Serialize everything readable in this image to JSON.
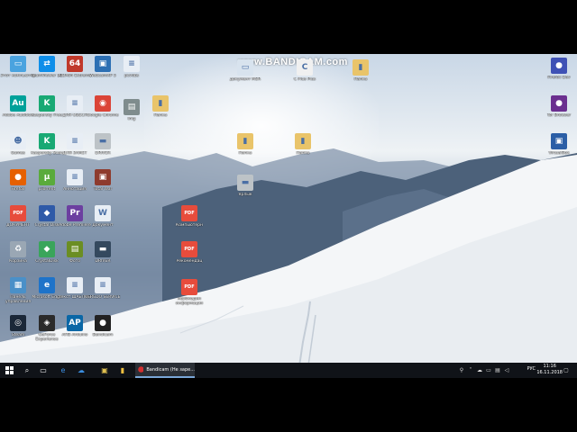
{
  "watermark": "www.BANDICAM.com",
  "taskbar": {
    "app_label": "Bandicam (Не заре...",
    "lang": "РУС",
    "time": "11:16",
    "date": "16.11.2018"
  },
  "icons": [
    {
      "id": "ic1",
      "label": "Этот компьютер",
      "color": "#4aa3df",
      "glyph": "▭"
    },
    {
      "id": "ic2",
      "label": "TeamViewer 13",
      "color": "#0e8ee9",
      "glyph": "⇄"
    },
    {
      "id": "ic3",
      "label": "AIDA64 Extreme",
      "color": "#c0392b",
      "glyph": "64"
    },
    {
      "id": "ic4",
      "label": "WebcamXP 5",
      "color": "#2c6fb3",
      "glyph": "▣"
    },
    {
      "id": "ic5",
      "label": "pcvdbs",
      "color": "#e8eef5",
      "glyph": "≡"
    },
    {
      "id": "ic6",
      "label": "документ MSR",
      "color": "#d8e3ee",
      "glyph": "▭"
    },
    {
      "id": "ic7",
      "label": "C Plus Plus",
      "color": "#f0f0f0",
      "glyph": "C"
    },
    {
      "id": "ic8",
      "label": "Папка",
      "color": "#e9c46a",
      "glyph": "▮"
    },
    {
      "id": "ic9",
      "label": "Adobe Audition",
      "color": "#00a19a",
      "glyph": "Au"
    },
    {
      "id": "ic10",
      "label": "Kaspersky Free",
      "color": "#19a974",
      "glyph": "K"
    },
    {
      "id": "ic11",
      "label": "ДЛЯ ОБЕСП",
      "color": "#e8eef5",
      "glyph": "≡"
    },
    {
      "id": "ic12",
      "label": "Google Chrome",
      "color": "#db4437",
      "glyph": "◉"
    },
    {
      "id": "ic13",
      "label": "Img",
      "color": "#7f8c8d",
      "glyph": "▤"
    },
    {
      "id": "ic14",
      "label": "Папка",
      "color": "#e9c46a",
      "glyph": "▮"
    },
    {
      "id": "ic15",
      "label": "Games",
      "color": "#e8eef5",
      "glyph": "☻"
    },
    {
      "id": "ic16",
      "label": "Kaspersky Scan",
      "color": "#19a974",
      "glyph": "K"
    },
    {
      "id": "ic17",
      "label": "ДЛЯ ЗАМЕТ",
      "color": "#e8eef5",
      "glyph": "≡"
    },
    {
      "id": "ic18",
      "label": "DRIVER",
      "color": "#bdc3c7",
      "glyph": "▬"
    },
    {
      "id": "ic19",
      "label": "Папка",
      "color": "#e9c46a",
      "glyph": "▮"
    },
    {
      "id": "ic20",
      "label": "Папка",
      "color": "#e9c46a",
      "glyph": "▮"
    },
    {
      "id": "ic21",
      "label": "Firefox",
      "color": "#e66000",
      "glyph": "●"
    },
    {
      "id": "ic22",
      "label": "µTorrent",
      "color": "#5aab3c",
      "glyph": "µ"
    },
    {
      "id": "ic23",
      "label": "Аннотация",
      "color": "#e8eef5",
      "glyph": "≡"
    },
    {
      "id": "ic24",
      "label": "Total War",
      "color": "#8e3b2d",
      "glyph": "▣"
    },
    {
      "id": "ic25",
      "label": "Ярлык",
      "color": "#bdc3c7",
      "glyph": "▬"
    },
    {
      "id": "ic26",
      "label": "ДОКУМЕНТ",
      "color": "#e74c3c",
      "glyph": "PDF"
    },
    {
      "id": "ic27",
      "label": "Crystal Disk",
      "color": "#2f5aa8",
      "glyph": "◆"
    },
    {
      "id": "ic28",
      "label": "Adobe Premiere",
      "color": "#6c3fa0",
      "glyph": "Pr"
    },
    {
      "id": "ic29",
      "label": "Документ",
      "color": "#e8eef5",
      "glyph": "W"
    },
    {
      "id": "ic30",
      "label": "Компьютерн",
      "color": "#e74c3c",
      "glyph": "PDF"
    },
    {
      "id": "ic31",
      "label": "Корзина",
      "color": "#9aa7b4",
      "glyph": "♻"
    },
    {
      "id": "ic32",
      "label": "CrystalDisk",
      "color": "#3aa55b",
      "glyph": "◆"
    },
    {
      "id": "ic33",
      "label": "Фото",
      "color": "#6b8e23",
      "glyph": "▤"
    },
    {
      "id": "ic34",
      "label": "DRIVER",
      "color": "#34495e",
      "glyph": "▬"
    },
    {
      "id": "ic35",
      "label": "Рекомендац",
      "color": "#e74c3c",
      "glyph": "PDF"
    },
    {
      "id": "ic36",
      "label": "Панель управления",
      "color": "#4a90c8",
      "glyph": "▦"
    },
    {
      "id": "ic37",
      "label": "Microsoft Edge",
      "color": "#1e73c9",
      "glyph": "e"
    },
    {
      "id": "ic38",
      "label": "текст ШАБЛОН",
      "color": "#e8eef5",
      "glyph": "≡"
    },
    {
      "id": "ic39",
      "label": "TEREDO SERVICE",
      "color": "#e8eef5",
      "glyph": "≡"
    },
    {
      "id": "ic40",
      "label": "необходим информация",
      "color": "#e74c3c",
      "glyph": "PDF"
    },
    {
      "id": "ic41",
      "label": "Steam",
      "color": "#1b2838",
      "glyph": "◎"
    },
    {
      "id": "ic42",
      "label": "GeForce Experience",
      "color": "#2b2b2b",
      "glyph": "◈"
    },
    {
      "id": "ic43",
      "label": "АПВ Arduino",
      "color": "#0a67a6",
      "glyph": "AP"
    },
    {
      "id": "ic44",
      "label": "Bandicam",
      "color": "#222",
      "glyph": "●"
    },
    {
      "id": "ic45",
      "label": "Firefox Dev",
      "color": "#3f51b5",
      "glyph": "●"
    },
    {
      "id": "ic46",
      "label": "Tor Browser",
      "color": "#6b2f8f",
      "glyph": "●"
    },
    {
      "id": "ic47",
      "label": "VirtualBox",
      "color": "#2b5ea6",
      "glyph": "▣"
    }
  ]
}
